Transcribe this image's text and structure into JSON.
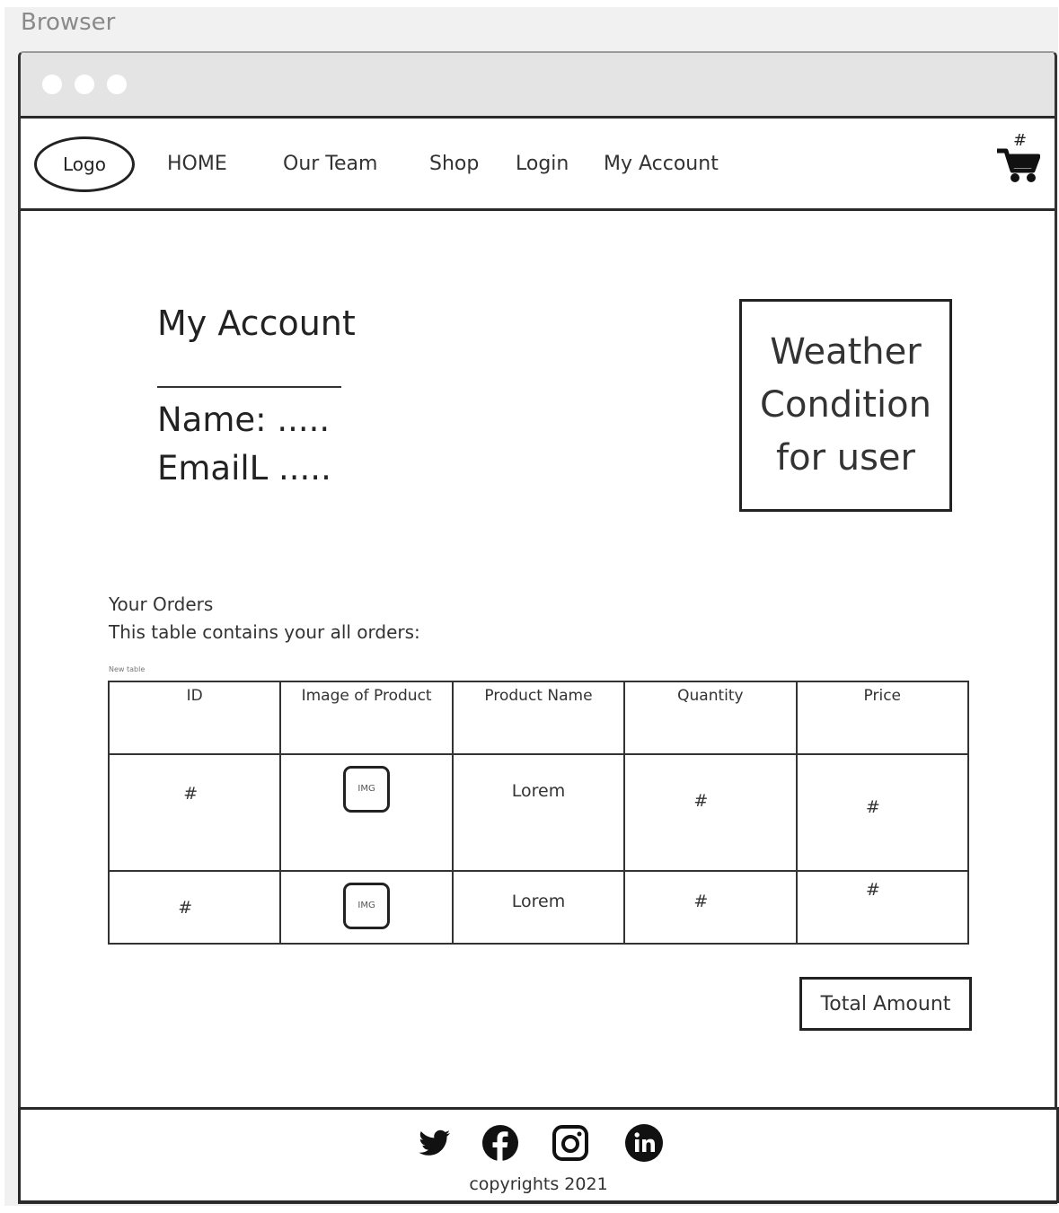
{
  "browser": {
    "label": "Browser"
  },
  "navbar": {
    "logo": "Logo",
    "links": [
      "HOME",
      "Our Team",
      "Shop",
      "Login",
      "My Account"
    ],
    "cart_count": "#"
  },
  "account": {
    "title": "My Account",
    "name_line": "Name: .....",
    "email_line": "EmailL ....."
  },
  "weather": {
    "text": "Weather Condition for user"
  },
  "orders": {
    "title": "Your Orders",
    "description": "This table contains your all orders:",
    "caption": "New table",
    "headers": [
      "ID",
      "Image of Product",
      "Product Name",
      "Quantity",
      "Price"
    ],
    "rows": [
      {
        "id": "#",
        "image": "IMG",
        "name": "Lorem",
        "quantity": "#",
        "price": "#"
      },
      {
        "id": "#",
        "image": "IMG",
        "name": "Lorem",
        "quantity": "#",
        "price": "#"
      }
    ],
    "total_label": "Total Amount"
  },
  "footer": {
    "social_icons": [
      "twitter-icon",
      "facebook-icon",
      "instagram-icon",
      "linkedin-icon"
    ],
    "copyright": "copyrights 2021"
  }
}
